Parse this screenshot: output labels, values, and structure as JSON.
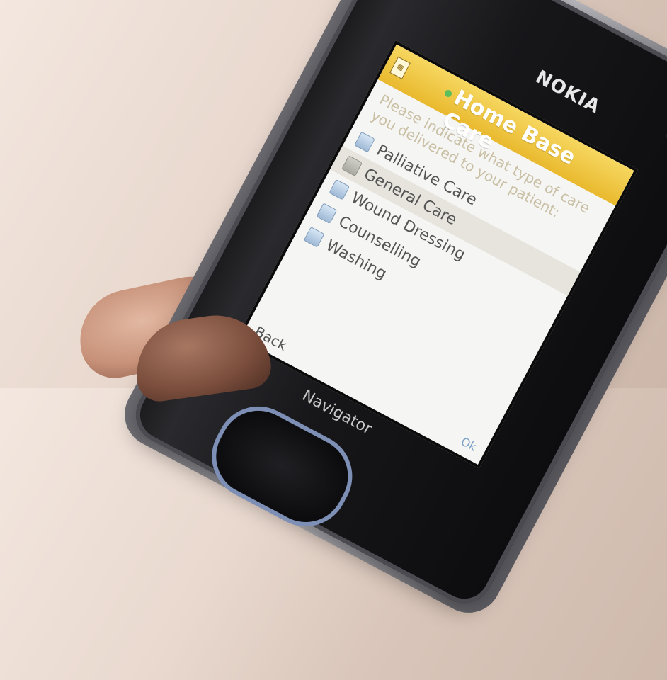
{
  "device": {
    "brand": "NOKIA",
    "navigator_label": "Navigator"
  },
  "app": {
    "title": "Home Base Care",
    "prompt": "Please indicate what type of care you delivered to your patient:",
    "options": [
      {
        "label": "Palliative Care",
        "checked": false,
        "selected": false
      },
      {
        "label": "General Care",
        "checked": false,
        "selected": true
      },
      {
        "label": "Wound Dressing",
        "checked": false,
        "selected": false
      },
      {
        "label": "Counselling",
        "checked": false,
        "selected": false
      },
      {
        "label": "Washing",
        "checked": false,
        "selected": false
      }
    ],
    "softkeys": {
      "left": "Back",
      "right": "Ok"
    }
  },
  "colors": {
    "title_bar": "#e9b92e",
    "accent_blue": "#4aa3ff"
  }
}
